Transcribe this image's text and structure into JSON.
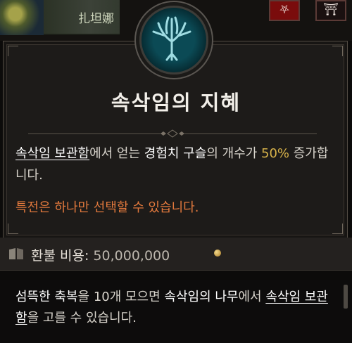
{
  "top": {
    "character_name": "扎坦娜",
    "slot_red_icon": "demon-icon",
    "slot_gate_icon": "gate-icon"
  },
  "panel": {
    "emblem_icon": "tree-emblem-icon",
    "title": "속삭임의 지혜",
    "description": {
      "p1_keyword": "속삭임 보관함",
      "p1_text_a": "에서 얻는 ",
      "p1_highlight": "경험치 구슬",
      "p1_text_b": "의 개수가 ",
      "p1_number": "50%",
      "p1_text_c": " 증가합니다."
    },
    "spec_note": "특전은 하나만 선택할 수 있습니다.",
    "accent_color": "#e2793d"
  },
  "refund": {
    "icon": "book-icon",
    "label": "환불 비용:",
    "value": "50,000,000",
    "currency_icon": "gold-coin-icon"
  },
  "hint": {
    "text_a": "섬뜩한 축복",
    "text_b": "을 10개 모으면 ",
    "text_c": "속삭임의 나무",
    "text_d": "에서 ",
    "keyword": "속삭임 보관함",
    "text_e": "을 고를 수 있습니다."
  }
}
